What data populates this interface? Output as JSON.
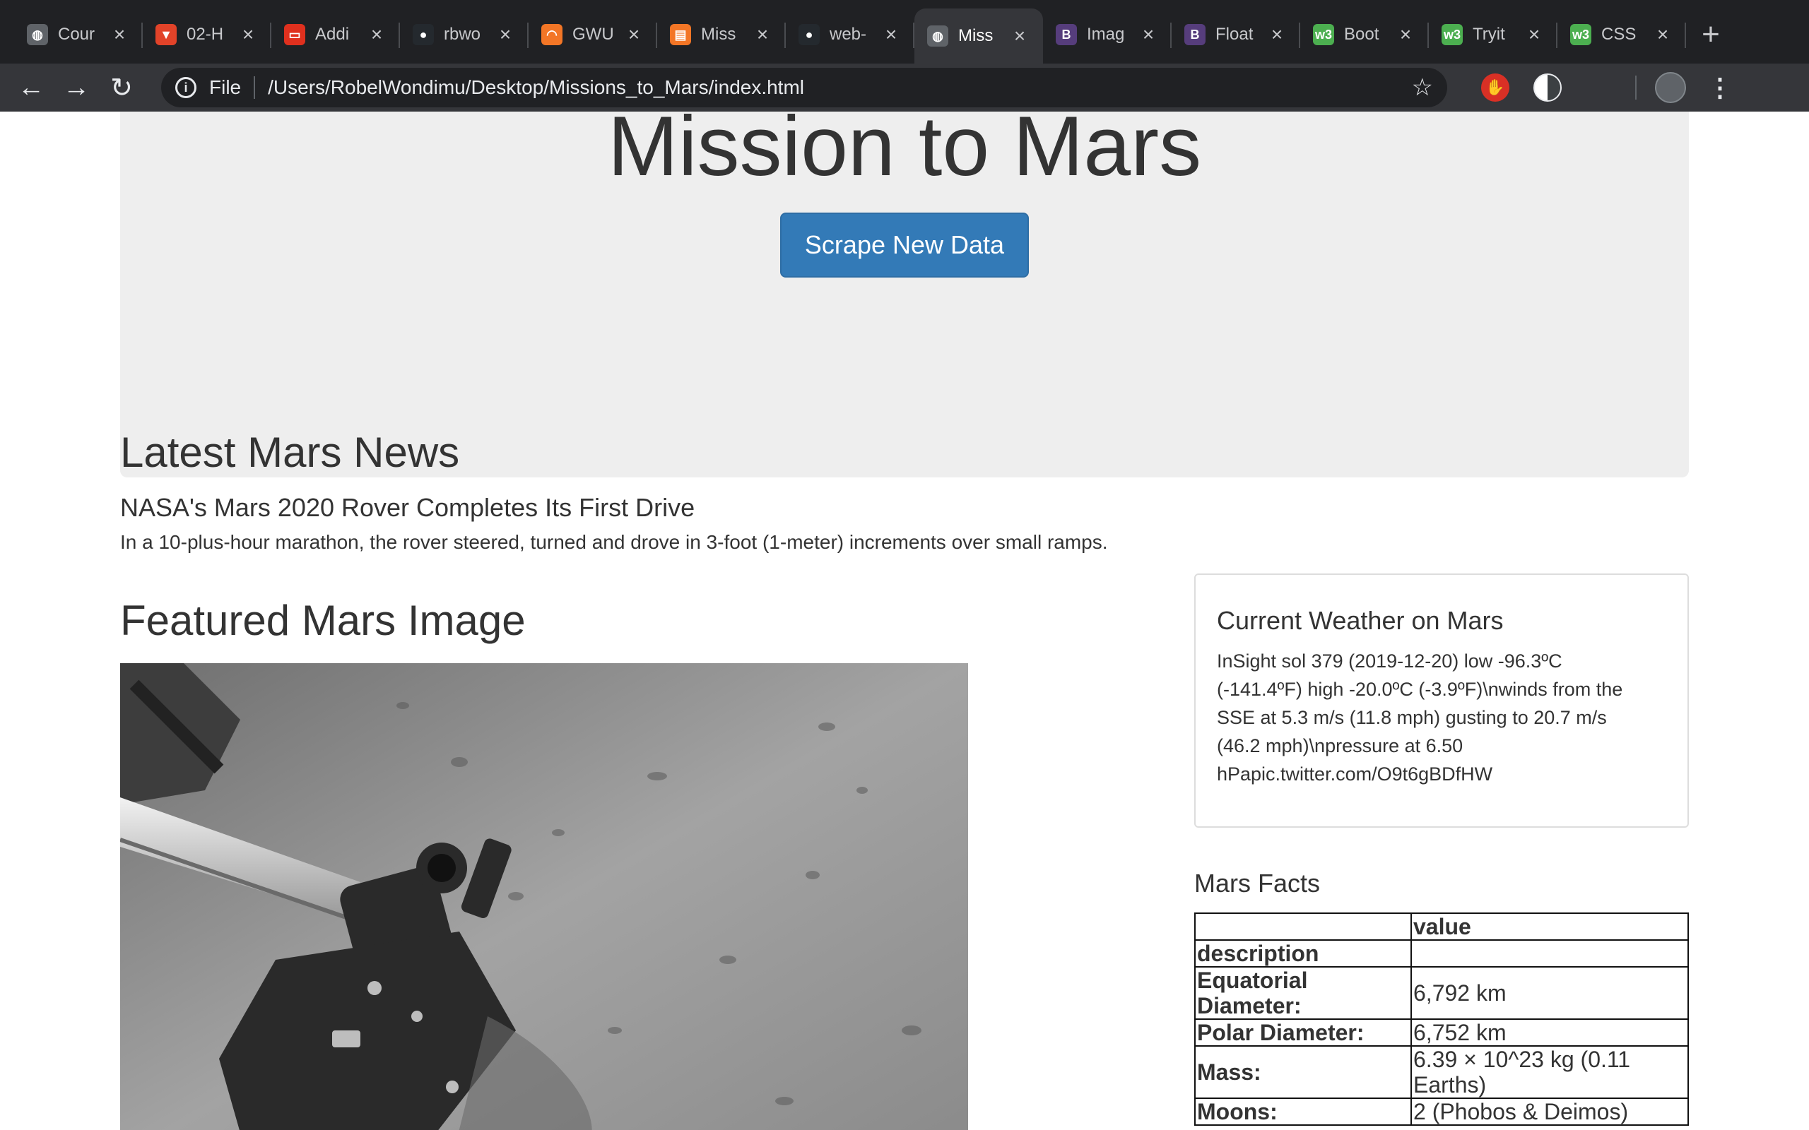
{
  "browser": {
    "tabs": [
      {
        "title": "Cour",
        "icon": "globe-icon",
        "color": "#5f6368"
      },
      {
        "title": "02-H",
        "icon": "gitlab-icon",
        "color": "#e24329"
      },
      {
        "title": "Addi",
        "icon": "oracle-icon",
        "color": "#e0301e"
      },
      {
        "title": "rbwo",
        "icon": "github-icon",
        "color": "#24292e"
      },
      {
        "title": "GWU",
        "icon": "jupyter-icon",
        "color": "#f37626"
      },
      {
        "title": "Miss",
        "icon": "book-icon",
        "color": "#f37626"
      },
      {
        "title": "web-",
        "icon": "github-icon",
        "color": "#24292e"
      },
      {
        "title": "Miss",
        "icon": "globe-icon",
        "color": "#5f6368"
      },
      {
        "title": "Imag",
        "icon": "bootstrap-icon",
        "color": "#563d7c"
      },
      {
        "title": "Float",
        "icon": "bootstrap-icon",
        "color": "#563d7c"
      },
      {
        "title": "Boot",
        "icon": "w3schools-icon",
        "color": "#4caf50"
      },
      {
        "title": "Tryit",
        "icon": "w3schools-icon",
        "color": "#4caf50"
      },
      {
        "title": "CSS",
        "icon": "w3schools-icon",
        "color": "#4caf50"
      }
    ],
    "active_tab_index": 7,
    "scheme_label": "File",
    "url": "/Users/RobelWondimu/Desktop/Missions_to_Mars/index.html"
  },
  "jumbotron": {
    "title": "Mission to Mars",
    "button_label": "Scrape New Data"
  },
  "news": {
    "heading": "Latest Mars News",
    "title": "NASA's Mars 2020 Rover Completes Its First Drive",
    "paragraph": "In a 10-plus-hour marathon, the rover steered, turned and drove in 3-foot (1-meter) increments over small ramps."
  },
  "featured": {
    "heading": "Featured Mars Image"
  },
  "weather": {
    "title": "Current Weather on Mars",
    "lines": [
      "InSight sol 379 (2019-12-20) low -96.3ºC",
      "(-141.4ºF) high -20.0ºC (-3.9ºF)\\nwinds from the",
      "SSE at 5.3 m/s (11.8 mph) gusting to 20.7 m/s",
      "(46.2 mph)\\npressure at 6.50",
      "hPapic.twitter.com/O9t6gBDfHW"
    ]
  },
  "facts": {
    "heading": "Mars Facts",
    "header_value": "value",
    "index_label": "description",
    "rows": [
      {
        "label_lines": [
          "Equatorial",
          "Diameter:"
        ],
        "value_lines": [
          "6,792 km"
        ]
      },
      {
        "label_lines": [
          "Polar Diameter:"
        ],
        "value_lines": [
          "6,752 km"
        ]
      },
      {
        "label_lines": [
          "Mass:"
        ],
        "value_lines": [
          "6.39 × 10^23 kg (0.11",
          "Earths)"
        ]
      },
      {
        "label_lines": [
          "Moons:"
        ],
        "value_lines": [
          "2 (Phobos & Deimos)"
        ]
      }
    ]
  }
}
